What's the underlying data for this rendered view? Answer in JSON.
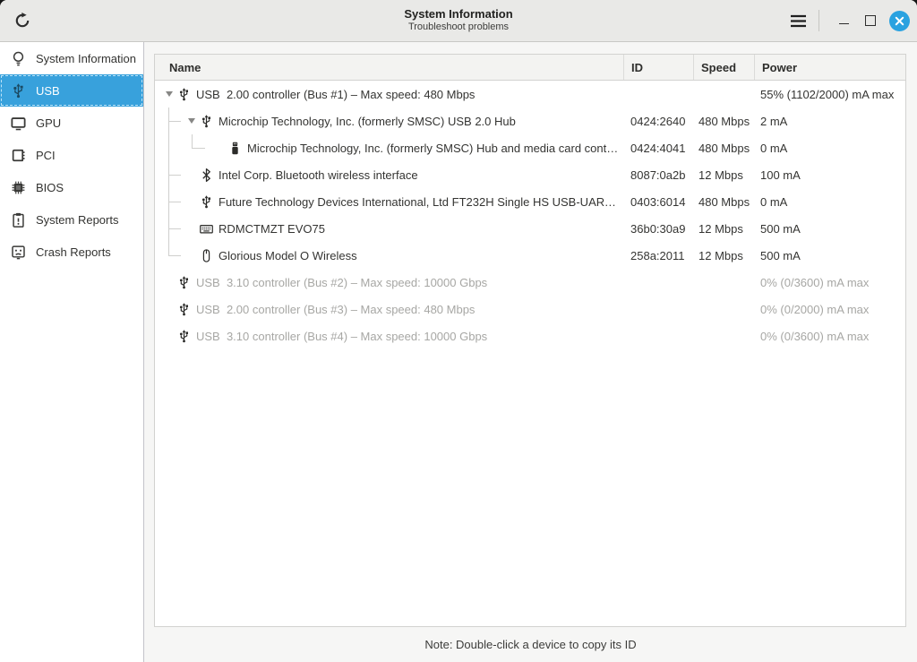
{
  "window": {
    "title": "System Information",
    "subtitle": "Troubleshoot problems"
  },
  "sidebar": {
    "items": [
      {
        "label": "System Information",
        "icon": "lightbulb-icon",
        "selected": false
      },
      {
        "label": "USB",
        "icon": "usb-icon",
        "selected": true
      },
      {
        "label": "GPU",
        "icon": "display-icon",
        "selected": false
      },
      {
        "label": "PCI",
        "icon": "pci-card-icon",
        "selected": false
      },
      {
        "label": "BIOS",
        "icon": "chip-icon",
        "selected": false
      },
      {
        "label": "System Reports",
        "icon": "clipboard-icon",
        "selected": false
      },
      {
        "label": "Crash Reports",
        "icon": "crash-face-icon",
        "selected": false
      }
    ]
  },
  "table": {
    "columns": [
      "Name",
      "ID",
      "Speed",
      "Power"
    ],
    "rows": [
      {
        "name": "USB  2.00 controller (Bus #1) – Max speed: 480 Mbps",
        "id": "",
        "speed": "",
        "power": "55% (1102/2000) mA max",
        "icon": "usb-icon",
        "level": 0,
        "expander": true,
        "branch": null,
        "dimmed": false
      },
      {
        "name": "Microchip Technology, Inc. (formerly SMSC) USB 2.0 Hub",
        "id": "0424:2640",
        "speed": "480 Mbps",
        "power": "2 mA",
        "icon": "usb-icon",
        "level": 1,
        "expander": true,
        "branch": "tee",
        "dimmed": false
      },
      {
        "name": "Microchip Technology, Inc. (formerly SMSC) Hub and media card cont…",
        "id": "0424:4041",
        "speed": "480 Mbps",
        "power": "0 mA",
        "icon": "usb-stick-icon",
        "level": 2,
        "expander": false,
        "branch": "elbow2",
        "dimmed": false
      },
      {
        "name": "Intel Corp. Bluetooth wireless interface",
        "id": "8087:0a2b",
        "speed": "12 Mbps",
        "power": "100 mA",
        "icon": "bluetooth-icon",
        "level": 1,
        "expander": false,
        "branch": "tee",
        "dimmed": false
      },
      {
        "name": "Future Technology Devices International, Ltd FT232H Single HS USB-UART…",
        "id": "0403:6014",
        "speed": "480 Mbps",
        "power": "0 mA",
        "icon": "usb-icon",
        "level": 1,
        "expander": false,
        "branch": "tee",
        "dimmed": false
      },
      {
        "name": "RDMCTMZT EVO75",
        "id": "36b0:30a9",
        "speed": "12 Mbps",
        "power": "500 mA",
        "icon": "keyboard-icon",
        "level": 1,
        "expander": false,
        "branch": "tee",
        "dimmed": false
      },
      {
        "name": "Glorious Model O Wireless",
        "id": "258a:2011",
        "speed": "12 Mbps",
        "power": "500 mA",
        "icon": "mouse-icon",
        "level": 1,
        "expander": false,
        "branch": "elbow",
        "dimmed": false
      },
      {
        "name": "USB  3.10 controller (Bus #2) – Max speed: 10000 Gbps",
        "id": "",
        "speed": "",
        "power": "0% (0/3600) mA max",
        "icon": "usb-icon",
        "level": 0,
        "expander": false,
        "branch": null,
        "dimmed": true
      },
      {
        "name": "USB  2.00 controller (Bus #3) – Max speed: 480 Mbps",
        "id": "",
        "speed": "",
        "power": "0% (0/2000) mA max",
        "icon": "usb-icon",
        "level": 0,
        "expander": false,
        "branch": null,
        "dimmed": true
      },
      {
        "name": "USB  3.10 controller (Bus #4) – Max speed: 10000 Gbps",
        "id": "",
        "speed": "",
        "power": "0% (0/3600) mA max",
        "icon": "usb-icon",
        "level": 0,
        "expander": false,
        "branch": null,
        "dimmed": true
      }
    ]
  },
  "footer": {
    "note": "Note: Double-click a device to copy its ID"
  },
  "colors": {
    "accent_selection": "#38a1dc",
    "close_button": "#2aa2e0",
    "dimmed_text": "#a7a7a4"
  }
}
